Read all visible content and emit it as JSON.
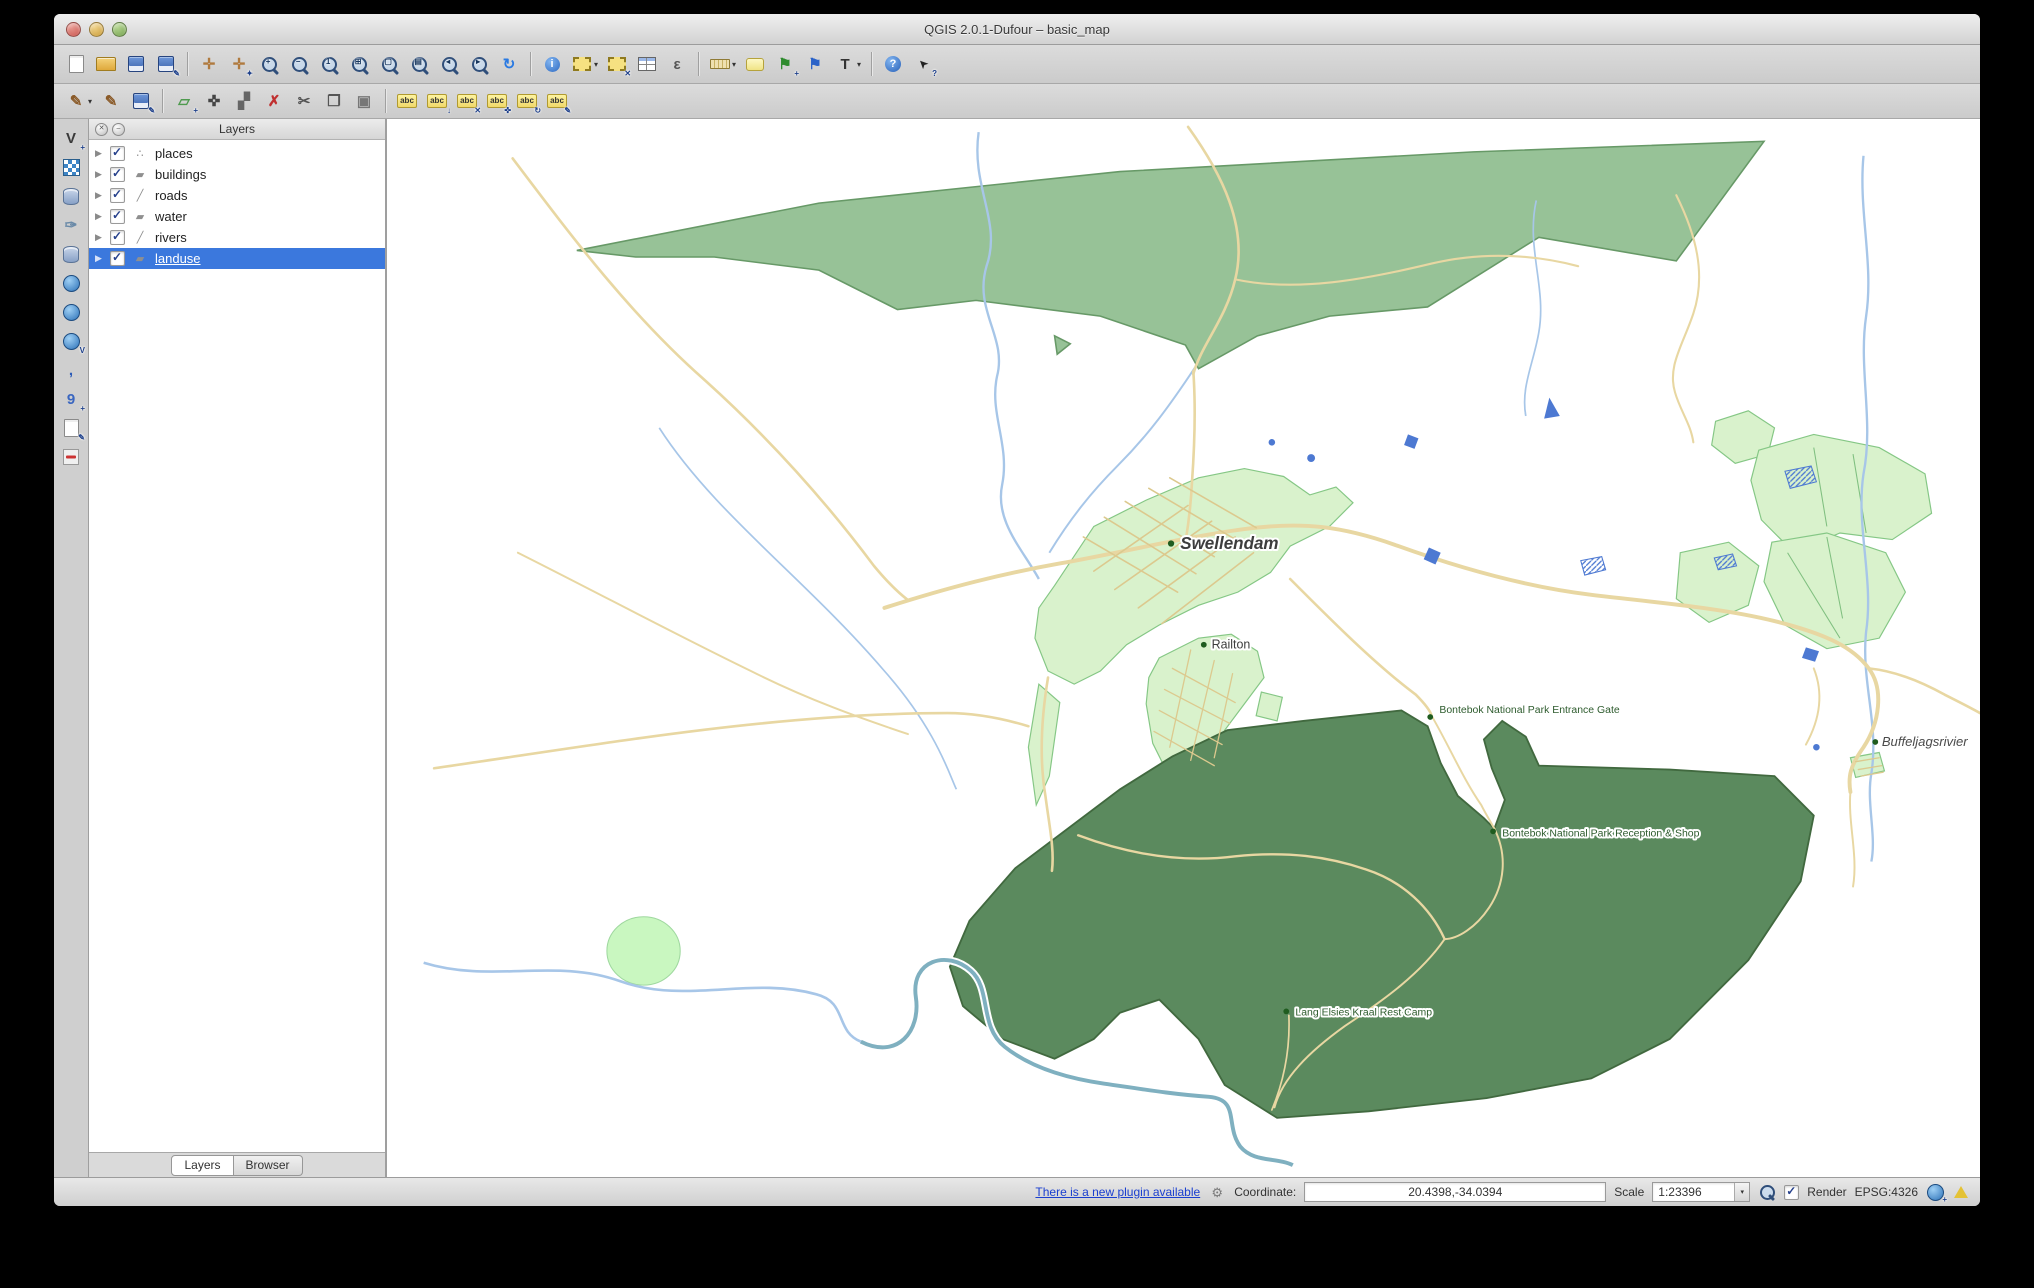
{
  "window": {
    "title": "QGIS 2.0.1-Dufour – basic_map"
  },
  "colors": {
    "selection_blue": "#3b78dd",
    "landuse_green": "#97c297",
    "landuse_border": "#679967",
    "park_green": "#5b8a5e",
    "park_border": "#41693f",
    "urban_green": "#d9f2cc",
    "urban_border": "#85c785",
    "circle_green": "#c9f7c0",
    "road_tan": "#e8d7a2",
    "road_light": "#ecdfb4",
    "road_grid": "#dcc98e",
    "river_blue": "#a7c6e8",
    "river_teal": "#7fb0c0",
    "water_blue": "#4d79d2",
    "link_blue": "#1a3fd0",
    "label_green": "#2e5c2e"
  },
  "toolbar_main": {
    "icons": [
      {
        "name": "new-project",
        "kind": "page"
      },
      {
        "name": "open-project",
        "kind": "folder"
      },
      {
        "name": "save-project",
        "kind": "floppy"
      },
      {
        "name": "save-project-as",
        "kind": "floppy",
        "overlay": "✎"
      },
      {
        "name": "sep1",
        "kind": "sep"
      },
      {
        "name": "pan-map",
        "kind": "glyph",
        "glyph": "✛",
        "color": "#b07a3e"
      },
      {
        "name": "pan-to-selection",
        "kind": "glyph",
        "glyph": "✛",
        "color": "#b07a3e",
        "overlay": "✦"
      },
      {
        "name": "zoom-in",
        "kind": "zoom",
        "overlay": "+"
      },
      {
        "name": "zoom-out",
        "kind": "zoom",
        "overlay": "−"
      },
      {
        "name": "zoom-native",
        "kind": "zoom",
        "overlay": "1"
      },
      {
        "name": "zoom-full",
        "kind": "zoom",
        "overlay": "⊞"
      },
      {
        "name": "zoom-to-selection",
        "kind": "zoom",
        "overlay": "▢"
      },
      {
        "name": "zoom-to-layer",
        "kind": "zoom",
        "overlay": "▤"
      },
      {
        "name": "zoom-last",
        "kind": "zoom",
        "overlay": "◂"
      },
      {
        "name": "zoom-next",
        "kind": "zoom",
        "overlay": "▸"
      },
      {
        "name": "refresh-map",
        "kind": "glyph",
        "glyph": "↻",
        "color": "#2a7ae2"
      },
      {
        "name": "sep2",
        "kind": "sep"
      },
      {
        "name": "identify-features",
        "kind": "info"
      },
      {
        "name": "select-features",
        "kind": "select",
        "dropdown": true
      },
      {
        "name": "deselect-features",
        "kind": "select",
        "overlay": "✕"
      },
      {
        "name": "open-attribute-table",
        "kind": "table"
      },
      {
        "name": "field-calculator",
        "kind": "glyph",
        "glyph": "ε",
        "color": "#555555"
      },
      {
        "name": "sep3",
        "kind": "sep"
      },
      {
        "name": "measure-line",
        "kind": "ruler",
        "dropdown": true
      },
      {
        "name": "map-tips",
        "kind": "bubble"
      },
      {
        "name": "new-bookmark",
        "kind": "glyph",
        "glyph": "⚑",
        "color": "#2e8b2e",
        "overlay": "+"
      },
      {
        "name": "show-bookmarks",
        "kind": "glyph",
        "glyph": "⚑",
        "color": "#2a62c8"
      },
      {
        "name": "text-annotation",
        "kind": "glyph",
        "glyph": "T",
        "color": "#333333",
        "dropdown": true
      },
      {
        "name": "sep4",
        "kind": "sep"
      },
      {
        "name": "help-contents",
        "kind": "help"
      },
      {
        "name": "whats-this",
        "kind": "cursor",
        "overlay": "?"
      }
    ]
  },
  "toolbar_edit": {
    "icons": [
      {
        "name": "current-edits",
        "kind": "glyph",
        "glyph": "✎",
        "color": "#8a5a28",
        "dropdown": true
      },
      {
        "name": "toggle-editing",
        "kind": "glyph",
        "glyph": "✎",
        "color": "#8a5a28"
      },
      {
        "name": "save-edits",
        "kind": "floppy",
        "overlay": "✎"
      },
      {
        "name": "sep1",
        "kind": "sep"
      },
      {
        "name": "add-feature",
        "kind": "glyph",
        "glyph": "▱",
        "color": "#4e9a4e",
        "overlay": "+"
      },
      {
        "name": "move-feature",
        "kind": "glyph",
        "glyph": "✜",
        "color": "#444444"
      },
      {
        "name": "node-tool",
        "kind": "glyph",
        "glyph": "▞",
        "color": "#666666"
      },
      {
        "name": "delete-selected",
        "kind": "glyph",
        "glyph": "✗",
        "color": "#c03030"
      },
      {
        "name": "cut-features",
        "kind": "glyph",
        "glyph": "✂",
        "color": "#555555"
      },
      {
        "name": "copy-features",
        "kind": "glyph",
        "glyph": "❐",
        "color": "#555555"
      },
      {
        "name": "paste-features",
        "kind": "glyph",
        "glyph": "▣",
        "color": "#777777"
      },
      {
        "name": "sep2",
        "kind": "sep"
      },
      {
        "name": "labeling",
        "kind": "abc"
      },
      {
        "name": "label-pin",
        "kind": "abc",
        "overlay": "↓"
      },
      {
        "name": "label-show-hide",
        "kind": "abc",
        "overlay": "✕"
      },
      {
        "name": "label-move",
        "kind": "abc",
        "overlay": "✜"
      },
      {
        "name": "label-rotate",
        "kind": "abc",
        "overlay": "↻"
      },
      {
        "name": "label-properties",
        "kind": "abc",
        "overlay": "✎"
      }
    ]
  },
  "toolbar_side": {
    "icons": [
      {
        "name": "add-vector-layer",
        "kind": "glyph",
        "glyph": "V",
        "color": "#3a3a3a",
        "overlay": "+"
      },
      {
        "name": "add-raster-layer",
        "kind": "raster"
      },
      {
        "name": "add-postgis-layer",
        "kind": "db"
      },
      {
        "name": "add-spatialite-layer",
        "kind": "glyph",
        "glyph": "✑",
        "color": "#6a8aa8"
      },
      {
        "name": "add-mssql-layer",
        "kind": "db"
      },
      {
        "name": "add-wms-layer",
        "kind": "globe"
      },
      {
        "name": "add-wcs-layer",
        "kind": "globe"
      },
      {
        "name": "add-wfs-layer",
        "kind": "globe",
        "overlay": "V"
      },
      {
        "name": "add-delimited-text-layer",
        "kind": "glyph",
        "glyph": ",",
        "color": "#2b5bb8"
      },
      {
        "name": "add-oracle-layer",
        "kind": "glyph",
        "glyph": "9",
        "color": "#3a66c0",
        "overlay": "+"
      },
      {
        "name": "new-shapefile-layer",
        "kind": "page",
        "overlay": "✎"
      },
      {
        "name": "remove-layer",
        "kind": "redsq"
      }
    ]
  },
  "layers_panel": {
    "title": "Layers",
    "items": [
      {
        "id": "places",
        "label": "places",
        "geom": "point",
        "checked": true,
        "selected": false
      },
      {
        "id": "buildings",
        "label": "buildings",
        "geom": "polygon",
        "checked": true,
        "selected": false
      },
      {
        "id": "roads",
        "label": "roads",
        "geom": "line",
        "checked": true,
        "selected": false
      },
      {
        "id": "water",
        "label": "water",
        "geom": "polygon",
        "checked": true,
        "selected": false
      },
      {
        "id": "rivers",
        "label": "rivers",
        "geom": "line",
        "checked": true,
        "selected": false
      },
      {
        "id": "landuse",
        "label": "landuse",
        "geom": "polygon",
        "checked": true,
        "selected": true
      }
    ],
    "tabs": [
      {
        "id": "layers",
        "label": "Layers",
        "active": true
      },
      {
        "id": "browser",
        "label": "Browser",
        "active": false
      }
    ]
  },
  "map": {
    "labels": {
      "swellendam": "Swellendam",
      "railton": "Railton",
      "entrance_gate": "Bontebok National Park Entrance Gate",
      "reception": "Bontebok National Park Reception & Shop",
      "rest_camp": "Lang Elsies Kraal Rest Camp",
      "buffeljagsrivier": "Buffeljagsrivier"
    }
  },
  "status_bar": {
    "plugin_link": "There is a new plugin available",
    "coordinate_label": "Coordinate:",
    "coordinate_value": "20.4398,-34.0394",
    "scale_label": "Scale",
    "scale_value": "1:23396",
    "render_label": "Render",
    "crs_label": "EPSG:4326",
    "icons": [
      "plugin-icon",
      "scale-magnifier-icon",
      "crs-status-icon",
      "messages-icon"
    ]
  }
}
